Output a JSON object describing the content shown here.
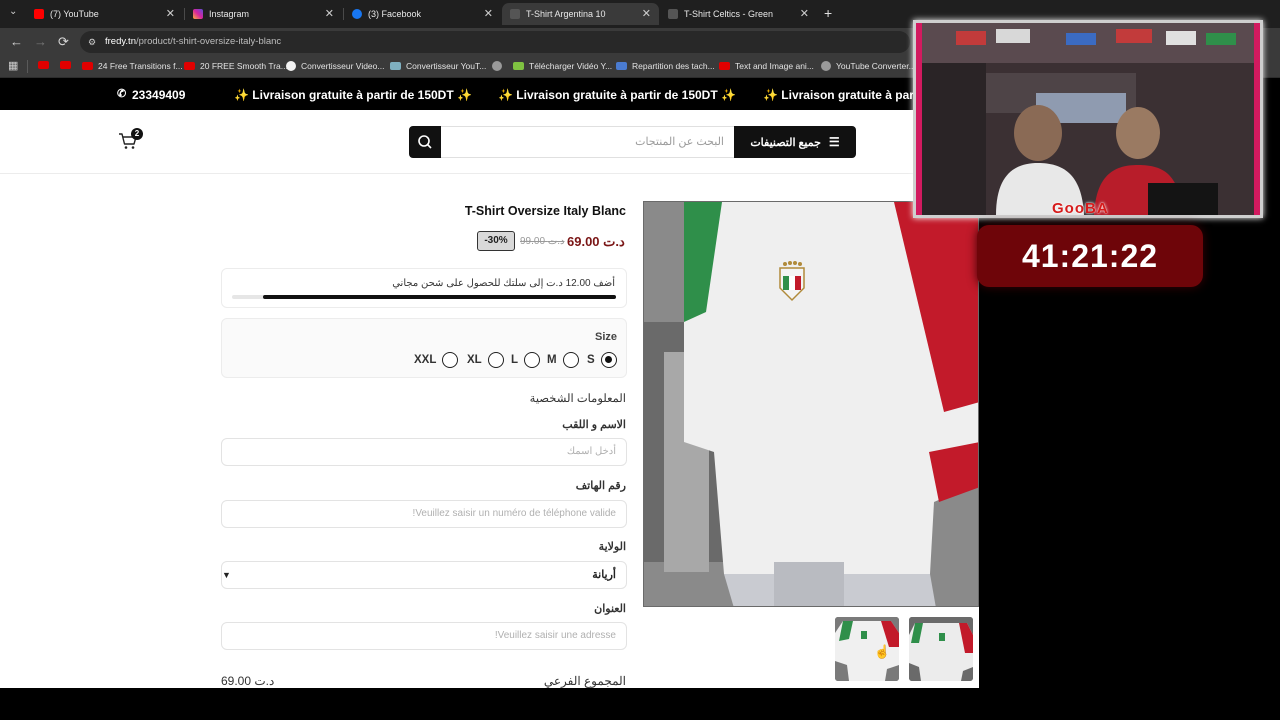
{
  "browser": {
    "tabs": [
      {
        "title": "(7) YouTube",
        "icon": "youtube-icon",
        "color": "#ff0000"
      },
      {
        "title": "Instagram",
        "icon": "instagram-icon",
        "color": "#d6249f"
      },
      {
        "title": "(3) Facebook",
        "icon": "facebook-icon",
        "color": "#1877f2"
      },
      {
        "title": "T-Shirt Argentina 10",
        "icon": "site-icon",
        "color": "#555555"
      },
      {
        "title": "T-Shirt Celtics - Green",
        "icon": "site-icon",
        "color": "#555555"
      }
    ],
    "url_host": "fredy.tn",
    "url_path": "/product/t-shirt-oversize-italy-blanc",
    "bookmarks": [
      {
        "label": "",
        "color": "#e00000"
      },
      {
        "label": "",
        "color": "#e00000"
      },
      {
        "label": "24 Free Transitions f...",
        "color": "#e00000"
      },
      {
        "label": "20 FREE Smooth Tra...",
        "color": "#e00000"
      },
      {
        "label": "Convertisseur Video...",
        "color": "#f2f2f2"
      },
      {
        "label": "Convertisseur YouT...",
        "color": "#7fb0c0"
      },
      {
        "label": "",
        "color": "#9a9a9a"
      },
      {
        "label": "Télécharger Vidéo Y...",
        "color": "#7fc241"
      },
      {
        "label": "Repartition des tach...",
        "color": "#4a7bd0"
      },
      {
        "label": "Text and Image ani...",
        "color": "#e00000"
      },
      {
        "label": "YouTube Converter...",
        "color": "#9a9a9a"
      }
    ]
  },
  "promo": {
    "phone": "23349409",
    "message": "✨ Livraison gratuite à partir de 150DT ✨",
    "message_cut": "✨ Livraison gratuite à partir d"
  },
  "header": {
    "search_placeholder": "البحث عن المنتجات",
    "categories_label": "جميع التصنيفات",
    "cart_count": "2"
  },
  "product": {
    "title": "T-Shirt Oversize Italy Blanc",
    "price": "69.00 د.ت",
    "old_price": "99.00 د.ت",
    "discount": "-30%",
    "shipping_text": "أضف 12.00 د.ت إلى سلتك للحصول على شحن مجاني",
    "shipping_progress": 0.92,
    "size_label": "Size",
    "sizes": [
      {
        "label": "XXL",
        "selected": false
      },
      {
        "label": "XL",
        "selected": false
      },
      {
        "label": "L",
        "selected": false
      },
      {
        "label": "M",
        "selected": false
      },
      {
        "label": "S",
        "selected": true
      }
    ]
  },
  "form": {
    "section_title": "المعلومات الشخصية",
    "name_label": "الاسم و اللقب",
    "name_placeholder": "أدخل اسمك",
    "phone_label": "رقم الهاتف",
    "phone_placeholder": "Veuillez saisir un numéro de téléphone valide!",
    "wilaya_label": "الولاية",
    "wilaya_value": "أريانة",
    "address_label": "العنوان",
    "address_placeholder": "Veuillez saisir une adresse!",
    "subtotal_label": "المجموع الفرعي",
    "subtotal_value": "69.00 د.ت"
  },
  "overlay": {
    "streamer_name": "GooBA",
    "timer": "41:21:22"
  },
  "colors": {
    "price_red": "#7a1515",
    "timer_bg": "#6e0509",
    "brand_black": "#111111"
  }
}
